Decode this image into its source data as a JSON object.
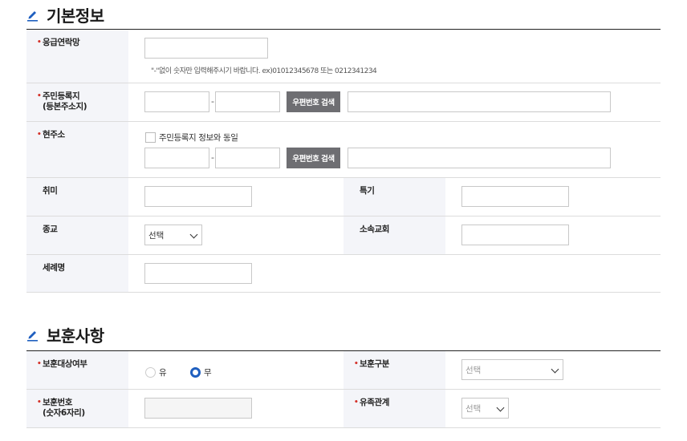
{
  "basic": {
    "title": "기본정보",
    "emergency_label": "응급연락망",
    "emergency_hint": "\"-\"없이 숫자만 입력해주시기 바랍니다. ex)01012345678 또는 0212341234",
    "reg_address_label_1": "주민등록지",
    "reg_address_label_2": "(등본주소지)",
    "zip_search_label": "우편번호 검색",
    "dash": "-",
    "current_address_label": "현주소",
    "same_as_reg_label": "주민등록지 정보와 동일",
    "hobby_label": "취미",
    "special_label": "특기",
    "religion_label": "종교",
    "religion_select": "선택",
    "church_label": "소속교회",
    "baptism_label": "세례명"
  },
  "veteran": {
    "title": "보훈사항",
    "target_label": "보훈대상여부",
    "option_yes": "유",
    "option_no": "무",
    "selected": "무",
    "type_label": "보훈구분",
    "type_select": "선택",
    "number_label_1": "보훈번호",
    "number_label_2": "(숫자6자리)",
    "relation_label": "유족관계",
    "relation_select": "선택"
  },
  "colors": {
    "required_dot": "#d4322a",
    "zip_button": "#6e6e72",
    "radio_active": "#1f5fbf",
    "label_bg": "#f4f5f9",
    "pen_icon": "#1f5fbf"
  }
}
